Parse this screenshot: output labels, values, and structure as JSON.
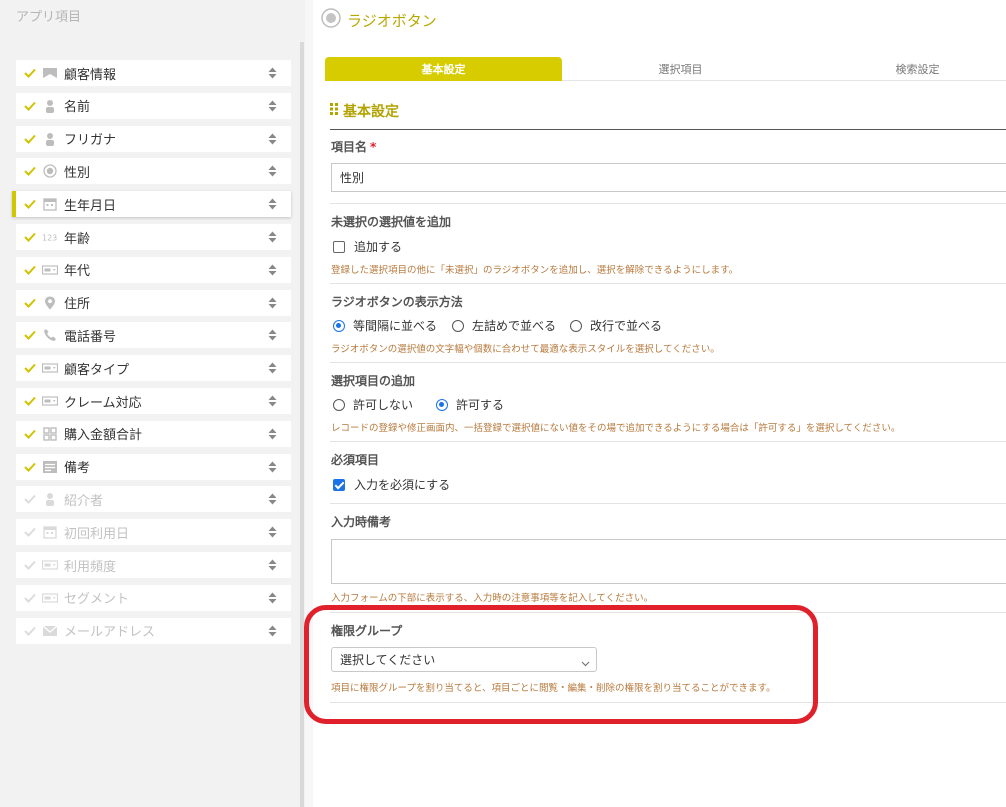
{
  "sidebar": {
    "title": "アプリ項目",
    "items": [
      {
        "label": "顧客情報",
        "icon": "id-card-icon",
        "checked": true,
        "enabled": true
      },
      {
        "label": "名前",
        "icon": "person-icon",
        "checked": true,
        "enabled": true
      },
      {
        "label": "フリガナ",
        "icon": "person-icon",
        "checked": true,
        "enabled": true
      },
      {
        "label": "性別",
        "icon": "radio-icon",
        "checked": true,
        "enabled": true
      },
      {
        "label": "生年月日",
        "icon": "calendar-icon",
        "checked": true,
        "enabled": true
      },
      {
        "label": "年齢",
        "icon": "number-icon",
        "checked": true,
        "enabled": true
      },
      {
        "label": "年代",
        "icon": "select-icon",
        "checked": true,
        "enabled": true
      },
      {
        "label": "住所",
        "icon": "map-pin-icon",
        "checked": true,
        "enabled": true
      },
      {
        "label": "電話番号",
        "icon": "phone-icon",
        "checked": true,
        "enabled": true
      },
      {
        "label": "顧客タイプ",
        "icon": "select-icon",
        "checked": true,
        "enabled": true
      },
      {
        "label": "クレーム対応",
        "icon": "select-icon",
        "checked": true,
        "enabled": true
      },
      {
        "label": "購入金額合計",
        "icon": "grid-icon",
        "checked": true,
        "enabled": true
      },
      {
        "label": "備考",
        "icon": "text-lines-icon",
        "checked": true,
        "enabled": true
      },
      {
        "label": "紹介者",
        "icon": "person-icon",
        "checked": false,
        "enabled": false
      },
      {
        "label": "初回利用日",
        "icon": "calendar-icon",
        "checked": false,
        "enabled": false
      },
      {
        "label": "利用頻度",
        "icon": "select-icon",
        "checked": false,
        "enabled": false
      },
      {
        "label": "セグメント",
        "icon": "select-icon",
        "checked": false,
        "enabled": false
      },
      {
        "label": "メールアドレス",
        "icon": "mail-icon",
        "checked": false,
        "enabled": false
      }
    ],
    "active_index": 4
  },
  "header": {
    "title": "ラジオボタン",
    "icon": "radio-icon"
  },
  "tabs": [
    {
      "label": "基本設定",
      "active": true
    },
    {
      "label": "選択項目",
      "active": false
    },
    {
      "label": "検索設定",
      "active": false
    }
  ],
  "section": {
    "title": "基本設定",
    "icon": "drag-handle-icon"
  },
  "fields": {
    "item_name": {
      "label": "項目名",
      "required_mark": "*",
      "value": "性別"
    },
    "unselected": {
      "label": "未選択の選択値を追加",
      "checkbox_label": "追加する",
      "checked": false,
      "hint": "登録した選択項目の他に「未選択」のラジオボタンを追加し、選択を解除できるようにします。"
    },
    "display": {
      "label": "ラジオボタンの表示方法",
      "options": [
        {
          "label": "等間隔に並べる",
          "selected": true
        },
        {
          "label": "左詰めで並べる",
          "selected": false
        },
        {
          "label": "改行で並べる",
          "selected": false
        }
      ],
      "hint": "ラジオボタンの選択値の文字幅や個数に合わせて最適な表示スタイルを選択してください。"
    },
    "add_option": {
      "label": "選択項目の追加",
      "options": [
        {
          "label": "許可しない",
          "selected": false
        },
        {
          "label": "許可する",
          "selected": true
        }
      ],
      "hint": "レコードの登録や修正画面内、一括登録で選択値にない値をその場で追加できるようにする場合は「許可する」を選択してください。"
    },
    "required": {
      "label": "必須項目",
      "checkbox_label": "入力を必須にする",
      "checked": true
    },
    "input_note": {
      "label": "入力時備考",
      "value": "",
      "hint": "入力フォームの下部に表示する、入力時の注意事項等を記入してください。"
    },
    "permission": {
      "label": "権限グループ",
      "selected": "選択してください",
      "hint": "項目に権限グループを割り当てると、項目ごとに閲覧・編集・削除の権限を割り当てることができます。"
    }
  },
  "colors": {
    "accent": "#d6cc00",
    "accent_text": "#b3a300",
    "hint": "#b77a3d",
    "highlight": "#e0202a",
    "control": "#1a73e8"
  }
}
